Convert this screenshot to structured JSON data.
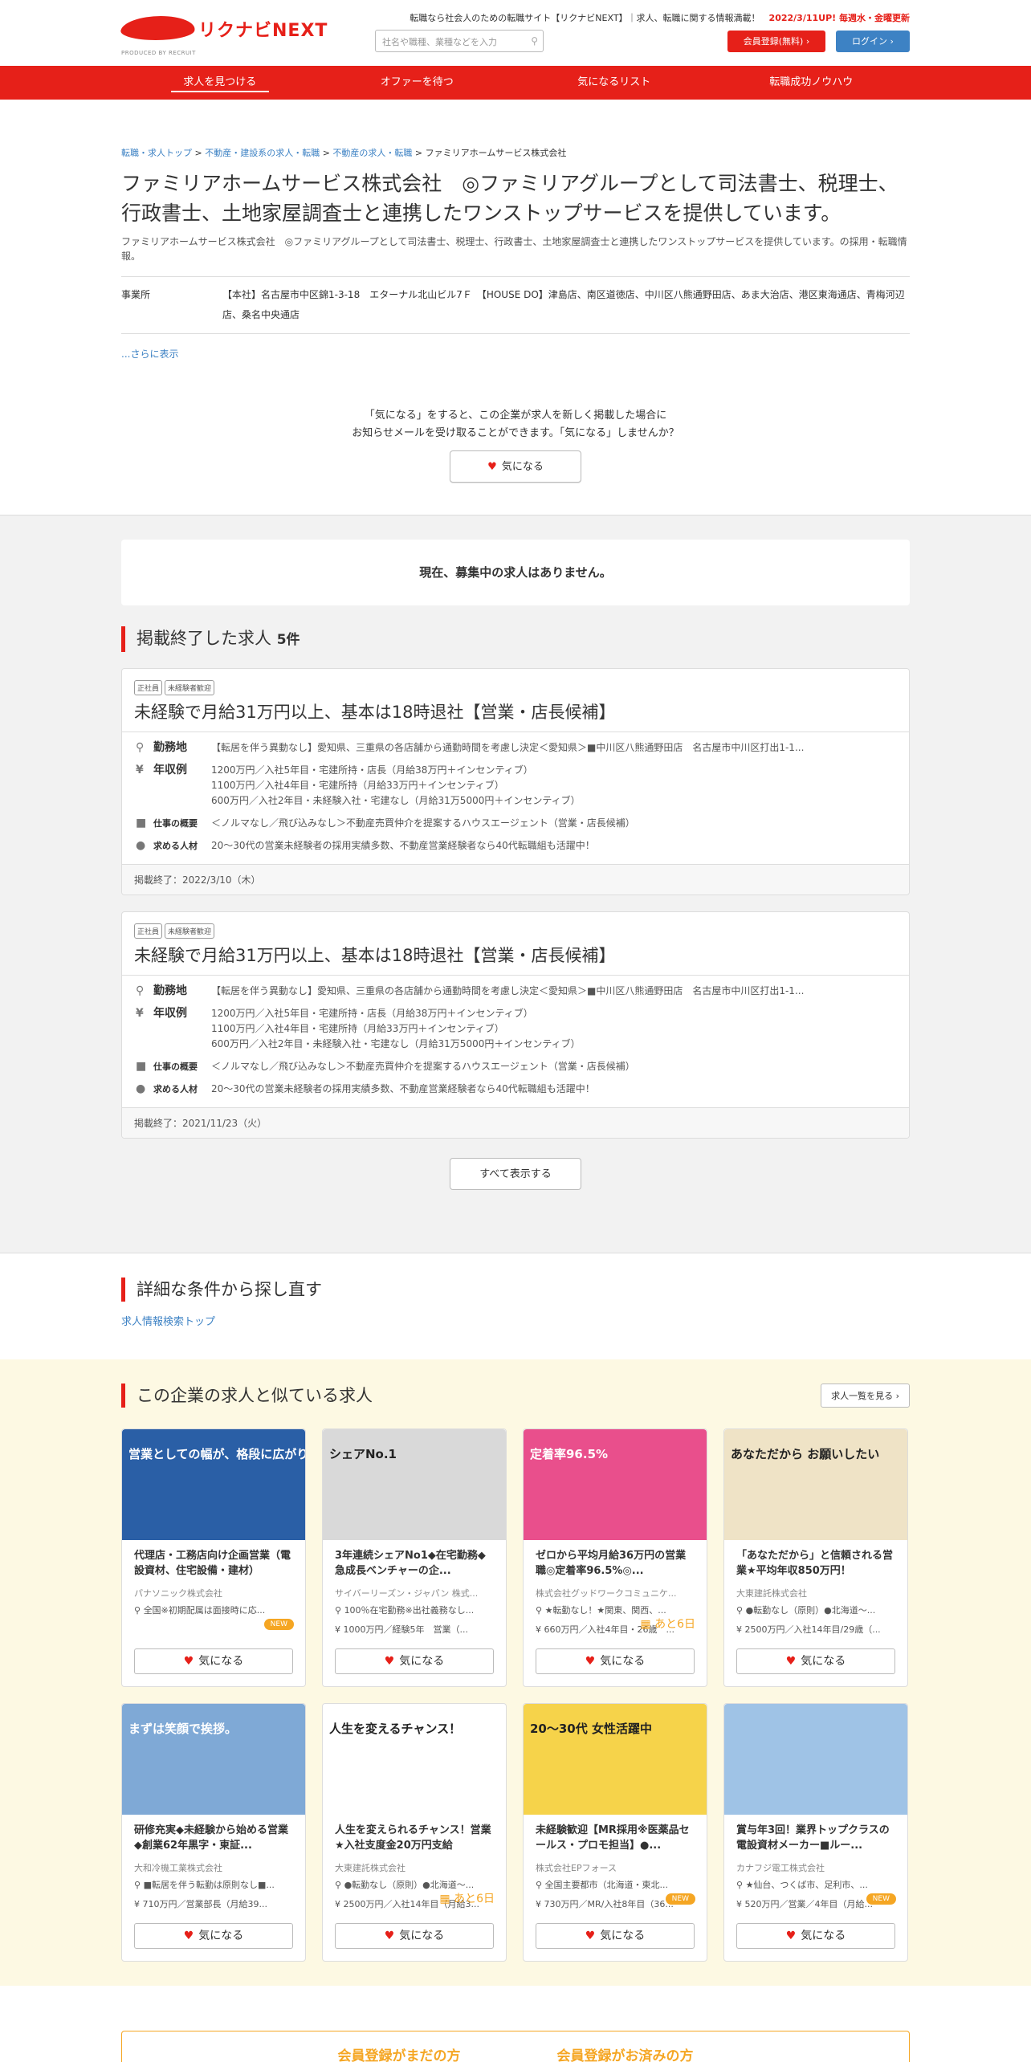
{
  "header": {
    "logo_text": "リクナビNEXT",
    "logo_sub": "PRODUCED BY RECRUIT",
    "tagline_prefix": "転職なら社会人のための転職サイト【リクナビNEXT】｜求人、転職に関する情報満載！",
    "tagline_update": "2022/3/11UP! 毎週水・金曜更新",
    "search_placeholder": "社名や職種、業種などを入力",
    "register_label": "会員登録(無料)",
    "login_label": "ログイン"
  },
  "nav": [
    {
      "label": "求人を見つける",
      "active": true
    },
    {
      "label": "オファーを待つ"
    },
    {
      "label": "気になるリスト"
    },
    {
      "label": "転職成功ノウハウ"
    }
  ],
  "breadcrumb": [
    "転職・求人トップ",
    "不動産・建設系の求人・転職",
    "不動産の求人・転職",
    "ファミリアホームサービス株式会社"
  ],
  "company": {
    "title": "ファミリアホームサービス株式会社　◎ファミリアグループとして司法書士、税理士、行政書士、土地家屋調査士と連携したワンストップサービスを提供しています。",
    "lead": "ファミリアホームサービス株式会社　◎ファミリアグループとして司法書士、税理士、行政書士、土地家屋調査士と連携したワンストップサービスを提供しています。の採用・転職情報。",
    "office_label": "事業所",
    "office_value": "【本社】名古屋市中区錦1-3-18　エターナル北山ビル7Ｆ　【HOUSE DO】津島店、南区道徳店、中川区八熊通野田店、あま大治店、港区東海通店、青梅河辺店、桑名中央通店",
    "more_label": "...さらに表示",
    "fav_note_1": "「気になる」をすると、この企業が求人を新しく掲載した場合に",
    "fav_note_2": "お知らせメールを受け取ることができます。「気になる」しませんか？",
    "fav_label": "気になる"
  },
  "jobs": {
    "no_jobs": "現在、募集中の求人はありません。",
    "ended_heading": "掲載終了した求人",
    "ended_count": "5件",
    "row_labels": {
      "location": "勤務地",
      "salary": "年収例",
      "summary": "仕事の概要",
      "target": "求める人材"
    },
    "cards": [
      {
        "tags": [
          "正社員",
          "未経験者歓迎"
        ],
        "title": "未経験で月給31万円以上、基本は18時退社【営業・店長候補】",
        "location": "【転居を伴う異動なし】愛知県、三重県の各店舗から通勤時間を考慮し決定＜愛知県＞■中川区八熊通野田店　名古屋市中川区打出1-1...",
        "salary": [
          "1200万円／入社5年目・宅建所持・店長（月給38万円＋インセンティブ）",
          "1100万円／入社4年目・宅建所持（月給33万円＋インセンティブ）",
          "600万円／入社2年目・未経験入社・宅建なし（月給31万5000円＋インセンティブ）"
        ],
        "summary": "＜ノルマなし／飛び込みなし＞不動産売買仲介を提案するハウスエージェント（営業・店長候補）",
        "target": "20～30代の営業未経験者の採用実績多数、不動産営業経験者なら40代転職組も活躍中！",
        "ended": "掲載終了：2022/3/10（木）"
      },
      {
        "tags": [
          "正社員",
          "未経験者歓迎"
        ],
        "title": "未経験で月給31万円以上、基本は18時退社【営業・店長候補】",
        "location": "【転居を伴う異動なし】愛知県、三重県の各店舗から通勤時間を考慮し決定＜愛知県＞■中川区八熊通野田店　名古屋市中川区打出1-1...",
        "salary": [
          "1200万円／入社5年目・宅建所持・店長（月給38万円＋インセンティブ）",
          "1100万円／入社4年目・宅建所持（月給33万円＋インセンティブ）",
          "600万円／入社2年目・未経験入社・宅建なし（月給31万5000円＋インセンティブ）"
        ],
        "summary": "＜ノルマなし／飛び込みなし＞不動産売買仲介を提案するハウスエージェント（営業・店長候補）",
        "target": "20～30代の営業未経験者の採用実績多数、不動産営業経験者なら40代転職組も活躍中！",
        "ended": "掲載終了：2021/11/23（火）"
      }
    ],
    "show_all": "すべて表示する"
  },
  "detail_search": {
    "heading": "詳細な条件から探し直す",
    "link": "求人情報検索トップ"
  },
  "similar": {
    "heading": "この企業の求人と似ている求人",
    "list_button": "求人一覧を見る",
    "fav_label": "気になる",
    "items": [
      {
        "thumb_text": "営業としての幅が、格段に広がりました。",
        "thumb_bg": "#2a5fa6",
        "title": "代理店・工務店向け企画営業（電設資材、住宅設備・建材）",
        "company": "パナソニック株式会社",
        "loc": "全国※初期配属は面接時に応...",
        "sal": "",
        "flag": "NEW"
      },
      {
        "thumb_text": "シェアNo.1",
        "thumb_bg": "#d9d9d9",
        "title": "3年連続シェアNo1◆在宅勤務◆急成長ベンチャーの企...",
        "company": "サイバーリーズン・ジャパン 株式...",
        "loc": "100％在宅勤務※出社義務なし...",
        "sal": "1000万円／経験5年　営業（...",
        "flag": ""
      },
      {
        "thumb_text": "定着率96.5%",
        "thumb_bg": "#e94f8c",
        "title": "ゼロから平均月給36万円の営業職◎定着率96.5%◎...",
        "company": "株式会社グッドワークコミュニケ...",
        "loc": "★転勤なし！★関東、関西、...",
        "sal": "660万円／入社4年目・26歳　...",
        "flag": "あと6日"
      },
      {
        "thumb_text": "あなただから お願いしたい",
        "thumb_bg": "#efe3c6",
        "title": "「あなただから」と信頼される営業★平均年収850万円！",
        "company": "大東建託株式会社",
        "loc": "●転勤なし（原則）●北海道～...",
        "sal": "2500万円／入社14年目/29歳（...",
        "flag": ""
      },
      {
        "thumb_text": "まずは笑顔で挨拶。",
        "thumb_bg": "#7fa9d6",
        "title": "研修充実◆未経験から始める営業◆創業62年黒字・東証...",
        "company": "大和冷機工業株式会社",
        "loc": "■転居を伴う転勤は原則なし■...",
        "sal": "710万円／営業部長（月給39...",
        "flag": ""
      },
      {
        "thumb_text": "人生を変えるチャンス！",
        "thumb_bg": "#ffffff",
        "title": "人生を変えられるチャンス！営業★入社支度金20万円支給",
        "company": "大東建託株式会社",
        "loc": "●転勤なし（原則）●北海道～...",
        "sal": "2500万円／入社14年目（月給3...",
        "flag": "あと6日"
      },
      {
        "thumb_text": "20～30代 女性活躍中",
        "thumb_bg": "#f6d34a",
        "title": "未経験歓迎【MR採用※医薬品セールス・プロモ担当】●...",
        "company": "株式会社EPフォース",
        "loc": "全国主要都市（北海道・東北...",
        "sal": "730万円／MR/入社8年目（36...",
        "flag": "NEW"
      },
      {
        "thumb_text": "",
        "thumb_bg": "#9fc3e6",
        "title": "賞与年3回！業界トップクラスの電設資材メーカー■ルー...",
        "company": "カナフジ電工株式会社",
        "loc": "★仙台、つくば市、足利市、...",
        "sal": "520万円／営業／4年目（月給...",
        "flag": "NEW"
      }
    ]
  },
  "bottom": {
    "left": "会員登録がまだの方",
    "right": "会員登録がお済みの方"
  },
  "colors": {
    "brand": "#e62019",
    "link": "#3d82c4",
    "accent": "#f5a623"
  }
}
